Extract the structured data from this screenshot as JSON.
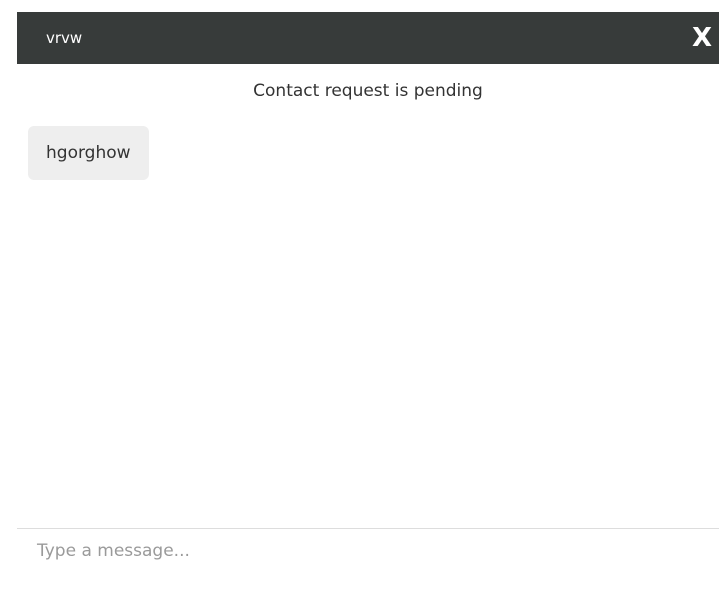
{
  "chat": {
    "title": "vrvw",
    "close_icon": "close-icon",
    "close_glyph": "X",
    "status": "Contact request is pending",
    "messages": [
      {
        "text": "hgorghow"
      }
    ],
    "composer": {
      "placeholder": "Type a message...",
      "value": ""
    }
  },
  "colors": {
    "header_bg": "#373b3a",
    "bubble_bg": "#eeeeee",
    "text": "#333333",
    "placeholder": "#9a9a9a"
  }
}
